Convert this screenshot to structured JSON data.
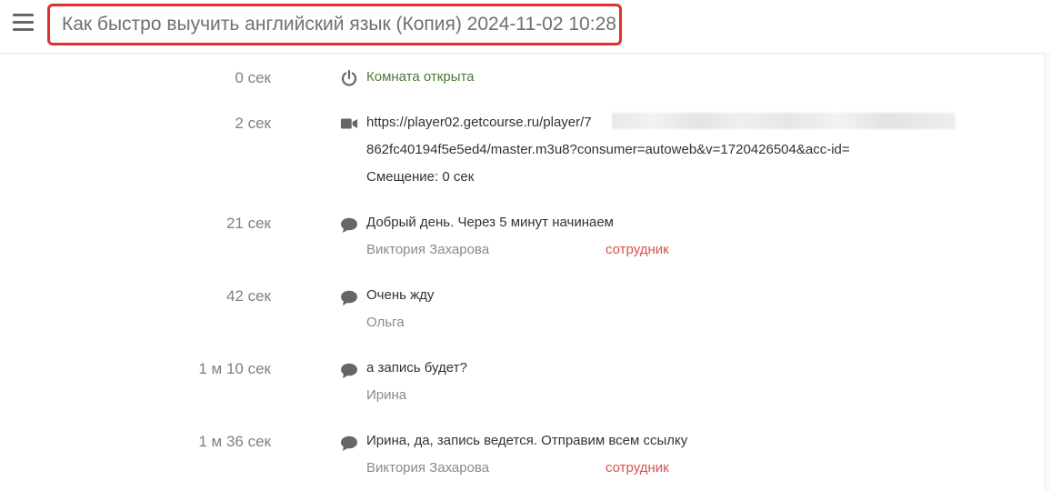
{
  "header": {
    "title": "Как быстро выучить английский язык (Копия) 2024-11-02 10:28"
  },
  "events": [
    {
      "time": "0 сек",
      "icon": "power-icon",
      "text": "Комната открыта"
    },
    {
      "time": "2 сек",
      "icon": "video-icon",
      "url_line1": "https://player02.getcourse.ru/player/7",
      "url_line2": "862fc40194f5e5ed4/master.m3u8?consumer=autoweb&v=1720426504&acc-id=",
      "offset": "Смещение: 0 сек"
    },
    {
      "time": "21 сек",
      "icon": "chat-icon",
      "text": "Добрый день. Через 5 минут начинаем",
      "author": "Виктория Захарова",
      "role": "сотрудник"
    },
    {
      "time": "42 сек",
      "icon": "chat-icon",
      "text": "Очень жду",
      "author": "Ольга"
    },
    {
      "time": "1 м 10 сек",
      "icon": "chat-icon",
      "text": "а запись будет?",
      "author": "Ирина"
    },
    {
      "time": "1 м 36 сек",
      "icon": "chat-icon",
      "text": "Ирина, да, запись ведется. Отправим всем ссылку",
      "author": "Виктория Захарова",
      "role": "сотрудник"
    }
  ],
  "colors": {
    "accent_border": "#e0302d",
    "role": "#d9534f",
    "system_text": "#4a7a3a"
  }
}
